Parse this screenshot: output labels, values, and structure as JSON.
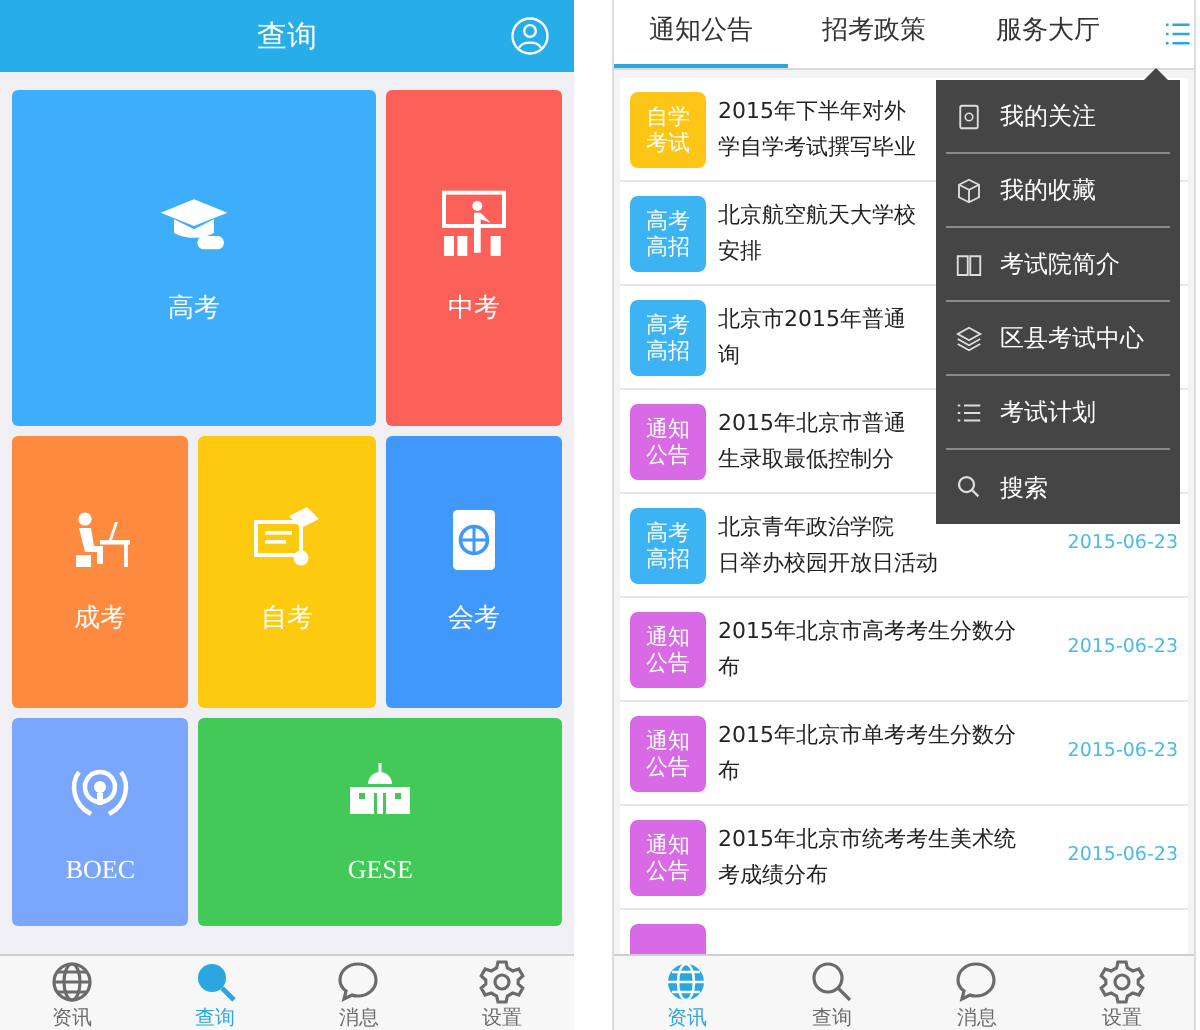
{
  "left_screen": {
    "header": {
      "title": "查询"
    },
    "tiles": [
      {
        "label": "高考",
        "kind": "graduation",
        "color": "#3eaefa"
      },
      {
        "label": "中考",
        "kind": "teacher",
        "color": "#fb6058"
      },
      {
        "label": "成考",
        "kind": "desk",
        "color": "#fd8a3e"
      },
      {
        "label": "自考",
        "kind": "certificate",
        "color": "#fdca10"
      },
      {
        "label": "会考",
        "kind": "passport",
        "color": "#3f98fa"
      },
      {
        "label": "BOEC",
        "kind": "emblem",
        "color": "#7aa7fb"
      },
      {
        "label": "GESE",
        "kind": "building",
        "color": "#42c958"
      }
    ],
    "tab_bar": [
      {
        "label": "资讯",
        "kind": "globe",
        "selected": false
      },
      {
        "label": "查询",
        "kind": "search",
        "selected": true
      },
      {
        "label": "消息",
        "kind": "chat",
        "selected": false
      },
      {
        "label": "设置",
        "kind": "gear",
        "selected": false
      }
    ]
  },
  "right_screen": {
    "tabs": [
      {
        "label": "通知公告",
        "selected": true
      },
      {
        "label": "招考政策",
        "selected": false
      },
      {
        "label": "服务大厅",
        "selected": false
      }
    ],
    "list": [
      {
        "tag": "自学考试",
        "color": "#fdc616",
        "title_lines": [
          "2015年下半年对外",
          "学自学考试撰写毕业"
        ]
      },
      {
        "tag": "高考高招",
        "color": "#3cb4f4",
        "title_lines": [
          "北京航空航天大学校",
          "安排"
        ]
      },
      {
        "tag": "高考高招",
        "color": "#3cb4f4",
        "title_lines": [
          "北京市2015年普通",
          "询"
        ]
      },
      {
        "tag": "通知公告",
        "color": "#d96ae6",
        "title_lines": [
          "2015年北京市普通",
          "生录取最低控制分"
        ]
      },
      {
        "tag": "高考高招",
        "color": "#3cb4f4",
        "title_lines": [
          "北京青年政治学院",
          "日举办校园开放日活动"
        ],
        "date": "2015-06-23"
      },
      {
        "tag": "通知公告",
        "color": "#d96ae6",
        "title_lines": [
          "2015年北京市高考考生分数分",
          "布"
        ],
        "date": "2015-06-23"
      },
      {
        "tag": "通知公告",
        "color": "#d96ae6",
        "title_lines": [
          "2015年北京市单考考生分数分",
          "布"
        ],
        "date": "2015-06-23"
      },
      {
        "tag": "通知公告",
        "color": "#d96ae6",
        "title_lines": [
          "2015年北京市统考考生美术统",
          "考成绩分布"
        ],
        "date": "2015-06-23"
      },
      {
        "color": "#d96ae6"
      }
    ],
    "menu": [
      {
        "label": "我的关注",
        "kind": "badge"
      },
      {
        "label": "我的收藏",
        "kind": "box"
      },
      {
        "label": "考试院简介",
        "kind": "book"
      },
      {
        "label": "区县考试中心",
        "kind": "layers"
      },
      {
        "label": "考试计划",
        "kind": "list"
      },
      {
        "label": "搜索",
        "kind": "search"
      }
    ],
    "tab_bar": [
      {
        "label": "资讯",
        "kind": "globe",
        "selected": true
      },
      {
        "label": "查询",
        "kind": "search",
        "selected": false
      },
      {
        "label": "消息",
        "kind": "chat",
        "selected": false
      },
      {
        "label": "设置",
        "kind": "gear",
        "selected": false
      }
    ]
  }
}
